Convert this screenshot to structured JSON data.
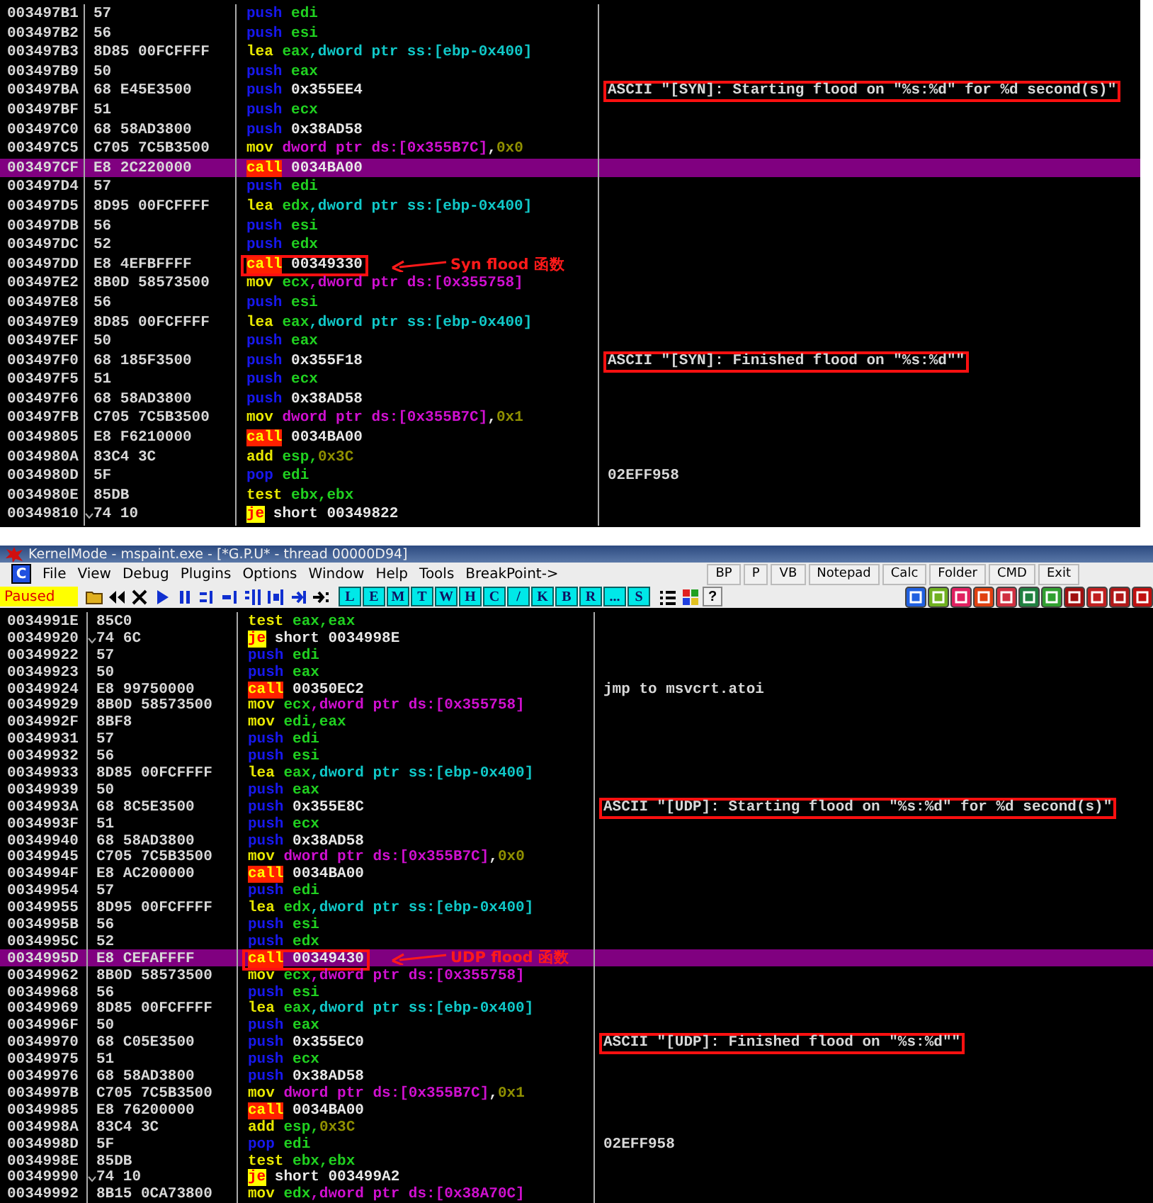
{
  "top_listing": {
    "rows": [
      {
        "address": "003497B1",
        "hex": "57",
        "mnemonic": {
          "text": "push",
          "kind": "stack"
        },
        "operands": [
          {
            "text": "edi",
            "kind": "reg"
          }
        ],
        "selected": false
      },
      {
        "address": "003497B2",
        "hex": "56",
        "mnemonic": {
          "text": "push",
          "kind": "stack"
        },
        "operands": [
          {
            "text": "esi",
            "kind": "reg"
          }
        ],
        "selected": false
      },
      {
        "address": "003497B3",
        "hex": "8D85 00FCFFFF",
        "mnemonic": {
          "text": "lea",
          "kind": "data"
        },
        "operands": [
          {
            "text": "eax",
            "kind": "reg"
          },
          {
            "text": ",dword ptr ss:[ebp-0x400]",
            "kind": "ss"
          }
        ],
        "selected": false
      },
      {
        "address": "003497B9",
        "hex": "50",
        "mnemonic": {
          "text": "push",
          "kind": "stack"
        },
        "operands": [
          {
            "text": "eax",
            "kind": "reg"
          }
        ],
        "selected": false
      },
      {
        "address": "003497BA",
        "hex": "68 E45E3500",
        "mnemonic": {
          "text": "push",
          "kind": "stack"
        },
        "operands": [
          {
            "text": "0x355EE4",
            "kind": "addr"
          }
        ],
        "selected": false,
        "comment": {
          "text": "ASCII \"[SYN]: Starting flood on \"%s:%d\" for %d second(s)\"",
          "boxed": true
        }
      },
      {
        "address": "003497BF",
        "hex": "51",
        "mnemonic": {
          "text": "push",
          "kind": "stack"
        },
        "operands": [
          {
            "text": "ecx",
            "kind": "reg"
          }
        ],
        "selected": false
      },
      {
        "address": "003497C0",
        "hex": "68 58AD3800",
        "mnemonic": {
          "text": "push",
          "kind": "stack"
        },
        "operands": [
          {
            "text": "0x38AD58",
            "kind": "addr"
          }
        ],
        "selected": false
      },
      {
        "address": "003497C5",
        "hex": "C705 7C5B3500",
        "mnemonic": {
          "text": "mov",
          "kind": "data"
        },
        "operands": [
          {
            "text": "dword ptr ds:[0x355B7C]",
            "kind": "ds"
          },
          {
            "text": ",",
            "kind": "addr"
          },
          {
            "text": "0x0",
            "kind": "imm"
          }
        ],
        "selected": false
      },
      {
        "address": "003497CF",
        "hex": "E8 2C220000",
        "mnemonic": {
          "text": "call",
          "kind": "call"
        },
        "operands": [
          {
            "text": "0034BA00",
            "kind": "addr"
          }
        ],
        "selected": true
      },
      {
        "address": "003497D4",
        "hex": "57",
        "mnemonic": {
          "text": "push",
          "kind": "stack"
        },
        "operands": [
          {
            "text": "edi",
            "kind": "reg"
          }
        ],
        "selected": false
      },
      {
        "address": "003497D5",
        "hex": "8D95 00FCFFFF",
        "mnemonic": {
          "text": "lea",
          "kind": "data"
        },
        "operands": [
          {
            "text": "edx",
            "kind": "reg"
          },
          {
            "text": ",dword ptr ss:[ebp-0x400]",
            "kind": "ss"
          }
        ],
        "selected": false
      },
      {
        "address": "003497DB",
        "hex": "56",
        "mnemonic": {
          "text": "push",
          "kind": "stack"
        },
        "operands": [
          {
            "text": "esi",
            "kind": "reg"
          }
        ],
        "selected": false
      },
      {
        "address": "003497DC",
        "hex": "52",
        "mnemonic": {
          "text": "push",
          "kind": "stack"
        },
        "operands": [
          {
            "text": "edx",
            "kind": "reg"
          }
        ],
        "selected": false
      },
      {
        "address": "003497DD",
        "hex": "E8 4EFBFFFF",
        "mnemonic": {
          "text": "call",
          "kind": "call"
        },
        "operands": [
          {
            "text": "00349330",
            "kind": "addr"
          }
        ],
        "selected": false,
        "boxed": true,
        "annotation": "Syn flood 函数"
      },
      {
        "address": "003497E2",
        "hex": "8B0D 58573500",
        "mnemonic": {
          "text": "mov",
          "kind": "data"
        },
        "operands": [
          {
            "text": "ecx",
            "kind": "reg"
          },
          {
            "text": ",dword ptr ds:[0x355758]",
            "kind": "ds"
          }
        ],
        "selected": false
      },
      {
        "address": "003497E8",
        "hex": "56",
        "mnemonic": {
          "text": "push",
          "kind": "stack"
        },
        "operands": [
          {
            "text": "esi",
            "kind": "reg"
          }
        ],
        "selected": false
      },
      {
        "address": "003497E9",
        "hex": "8D85 00FCFFFF",
        "mnemonic": {
          "text": "lea",
          "kind": "data"
        },
        "operands": [
          {
            "text": "eax",
            "kind": "reg"
          },
          {
            "text": ",dword ptr ss:[ebp-0x400]",
            "kind": "ss"
          }
        ],
        "selected": false
      },
      {
        "address": "003497EF",
        "hex": "50",
        "mnemonic": {
          "text": "push",
          "kind": "stack"
        },
        "operands": [
          {
            "text": "eax",
            "kind": "reg"
          }
        ],
        "selected": false
      },
      {
        "address": "003497F0",
        "hex": "68 185F3500",
        "mnemonic": {
          "text": "push",
          "kind": "stack"
        },
        "operands": [
          {
            "text": "0x355F18",
            "kind": "addr"
          }
        ],
        "selected": false,
        "comment": {
          "text": "ASCII \"[SYN]: Finished flood on \"%s:%d\"\"",
          "boxed": true
        }
      },
      {
        "address": "003497F5",
        "hex": "51",
        "mnemonic": {
          "text": "push",
          "kind": "stack"
        },
        "operands": [
          {
            "text": "ecx",
            "kind": "reg"
          }
        ],
        "selected": false
      },
      {
        "address": "003497F6",
        "hex": "68 58AD3800",
        "mnemonic": {
          "text": "push",
          "kind": "stack"
        },
        "operands": [
          {
            "text": "0x38AD58",
            "kind": "addr"
          }
        ],
        "selected": false
      },
      {
        "address": "003497FB",
        "hex": "C705 7C5B3500",
        "mnemonic": {
          "text": "mov",
          "kind": "data"
        },
        "operands": [
          {
            "text": "dword ptr ds:[0x355B7C]",
            "kind": "ds"
          },
          {
            "text": ",",
            "kind": "addr"
          },
          {
            "text": "0x1",
            "kind": "imm"
          }
        ],
        "selected": false
      },
      {
        "address": "00349805",
        "hex": "E8 F6210000",
        "mnemonic": {
          "text": "call",
          "kind": "call"
        },
        "operands": [
          {
            "text": "0034BA00",
            "kind": "addr"
          }
        ],
        "selected": false
      },
      {
        "address": "0034980A",
        "hex": "83C4 3C",
        "mnemonic": {
          "text": "add",
          "kind": "data"
        },
        "operands": [
          {
            "text": "esp,",
            "kind": "reg"
          },
          {
            "text": "0x3C",
            "kind": "imm"
          }
        ],
        "selected": false
      },
      {
        "address": "0034980D",
        "hex": "5F",
        "mnemonic": {
          "text": "pop",
          "kind": "stack"
        },
        "operands": [
          {
            "text": "edi",
            "kind": "reg"
          }
        ],
        "selected": false,
        "comment": {
          "text": "02EFF958",
          "boxed": false
        }
      },
      {
        "address": "0034980E",
        "hex": "85DB",
        "mnemonic": {
          "text": "test",
          "kind": "data"
        },
        "operands": [
          {
            "text": "ebx,ebx",
            "kind": "reg"
          }
        ],
        "selected": false
      },
      {
        "address": "00349810",
        "hex": "74 10",
        "mnemonic": {
          "text": "je",
          "kind": "jump"
        },
        "operands": [
          {
            "text": "short 00349822",
            "kind": "addr"
          }
        ],
        "selected": false,
        "jump_mark": true
      }
    ]
  },
  "window": {
    "title": "KernelMode - mspaint.exe - [*G.P.U* - thread 00000D94]",
    "menu_badge": "C",
    "menu": [
      "File",
      "View",
      "Debug",
      "Plugins",
      "Options",
      "Window",
      "Help",
      "Tools",
      "BreakPoint->"
    ],
    "menu_buttons": [
      "BP",
      "P",
      "VB",
      "Notepad",
      "Calc",
      "Folder",
      "CMD",
      "Exit"
    ],
    "status": "Paused",
    "letter_buttons": [
      "L",
      "E",
      "M",
      "T",
      "W",
      "H",
      "C",
      "/",
      "K",
      "B",
      "R",
      "...",
      "S"
    ],
    "help_button": "?"
  },
  "bottom_listing": {
    "rows": [
      {
        "address": "0034991E",
        "hex": "85C0",
        "mnemonic": {
          "text": "test",
          "kind": "data"
        },
        "operands": [
          {
            "text": "eax,eax",
            "kind": "reg"
          }
        ],
        "selected": false
      },
      {
        "address": "00349920",
        "hex": "74 6C",
        "mnemonic": {
          "text": "je",
          "kind": "jump"
        },
        "operands": [
          {
            "text": "short 0034998E",
            "kind": "addr"
          }
        ],
        "selected": false,
        "jump_mark": true
      },
      {
        "address": "00349922",
        "hex": "57",
        "mnemonic": {
          "text": "push",
          "kind": "stack"
        },
        "operands": [
          {
            "text": "edi",
            "kind": "reg"
          }
        ],
        "selected": false
      },
      {
        "address": "00349923",
        "hex": "50",
        "mnemonic": {
          "text": "push",
          "kind": "stack"
        },
        "operands": [
          {
            "text": "eax",
            "kind": "reg"
          }
        ],
        "selected": false
      },
      {
        "address": "00349924",
        "hex": "E8 99750000",
        "mnemonic": {
          "text": "call",
          "kind": "call"
        },
        "operands": [
          {
            "text": "00350EC2",
            "kind": "addr"
          }
        ],
        "selected": false,
        "comment": {
          "text": "jmp to msvcrt.atoi",
          "boxed": false
        }
      },
      {
        "address": "00349929",
        "hex": "8B0D 58573500",
        "mnemonic": {
          "text": "mov",
          "kind": "data"
        },
        "operands": [
          {
            "text": "ecx",
            "kind": "reg"
          },
          {
            "text": ",dword ptr ds:[0x355758]",
            "kind": "ds"
          }
        ],
        "selected": false
      },
      {
        "address": "0034992F",
        "hex": "8BF8",
        "mnemonic": {
          "text": "mov",
          "kind": "data"
        },
        "operands": [
          {
            "text": "edi,eax",
            "kind": "reg"
          }
        ],
        "selected": false
      },
      {
        "address": "00349931",
        "hex": "57",
        "mnemonic": {
          "text": "push",
          "kind": "stack"
        },
        "operands": [
          {
            "text": "edi",
            "kind": "reg"
          }
        ],
        "selected": false
      },
      {
        "address": "00349932",
        "hex": "56",
        "mnemonic": {
          "text": "push",
          "kind": "stack"
        },
        "operands": [
          {
            "text": "esi",
            "kind": "reg"
          }
        ],
        "selected": false
      },
      {
        "address": "00349933",
        "hex": "8D85 00FCFFFF",
        "mnemonic": {
          "text": "lea",
          "kind": "data"
        },
        "operands": [
          {
            "text": "eax",
            "kind": "reg"
          },
          {
            "text": ",dword ptr ss:[ebp-0x400]",
            "kind": "ss"
          }
        ],
        "selected": false
      },
      {
        "address": "00349939",
        "hex": "50",
        "mnemonic": {
          "text": "push",
          "kind": "stack"
        },
        "operands": [
          {
            "text": "eax",
            "kind": "reg"
          }
        ],
        "selected": false
      },
      {
        "address": "0034993A",
        "hex": "68 8C5E3500",
        "mnemonic": {
          "text": "push",
          "kind": "stack"
        },
        "operands": [
          {
            "text": "0x355E8C",
            "kind": "addr"
          }
        ],
        "selected": false,
        "comment": {
          "text": "ASCII \"[UDP]: Starting flood on \"%s:%d\" for %d second(s)\"",
          "boxed": true
        }
      },
      {
        "address": "0034993F",
        "hex": "51",
        "mnemonic": {
          "text": "push",
          "kind": "stack"
        },
        "operands": [
          {
            "text": "ecx",
            "kind": "reg"
          }
        ],
        "selected": false
      },
      {
        "address": "00349940",
        "hex": "68 58AD3800",
        "mnemonic": {
          "text": "push",
          "kind": "stack"
        },
        "operands": [
          {
            "text": "0x38AD58",
            "kind": "addr"
          }
        ],
        "selected": false
      },
      {
        "address": "00349945",
        "hex": "C705 7C5B3500",
        "mnemonic": {
          "text": "mov",
          "kind": "data"
        },
        "operands": [
          {
            "text": "dword ptr ds:[0x355B7C]",
            "kind": "ds"
          },
          {
            "text": ",",
            "kind": "addr"
          },
          {
            "text": "0x0",
            "kind": "imm"
          }
        ],
        "selected": false
      },
      {
        "address": "0034994F",
        "hex": "E8 AC200000",
        "mnemonic": {
          "text": "call",
          "kind": "call"
        },
        "operands": [
          {
            "text": "0034BA00",
            "kind": "addr"
          }
        ],
        "selected": false
      },
      {
        "address": "00349954",
        "hex": "57",
        "mnemonic": {
          "text": "push",
          "kind": "stack"
        },
        "operands": [
          {
            "text": "edi",
            "kind": "reg"
          }
        ],
        "selected": false
      },
      {
        "address": "00349955",
        "hex": "8D95 00FCFFFF",
        "mnemonic": {
          "text": "lea",
          "kind": "data"
        },
        "operands": [
          {
            "text": "edx",
            "kind": "reg"
          },
          {
            "text": ",dword ptr ss:[ebp-0x400]",
            "kind": "ss"
          }
        ],
        "selected": false
      },
      {
        "address": "0034995B",
        "hex": "56",
        "mnemonic": {
          "text": "push",
          "kind": "stack"
        },
        "operands": [
          {
            "text": "esi",
            "kind": "reg"
          }
        ],
        "selected": false
      },
      {
        "address": "0034995C",
        "hex": "52",
        "mnemonic": {
          "text": "push",
          "kind": "stack"
        },
        "operands": [
          {
            "text": "edx",
            "kind": "reg"
          }
        ],
        "selected": false
      },
      {
        "address": "0034995D",
        "hex": "E8 CEFAFFFF",
        "mnemonic": {
          "text": "call",
          "kind": "call"
        },
        "operands": [
          {
            "text": "00349430",
            "kind": "addr"
          }
        ],
        "selected": true,
        "boxed": true,
        "annotation": "UDP flood 函数"
      },
      {
        "address": "00349962",
        "hex": "8B0D 58573500",
        "mnemonic": {
          "text": "mov",
          "kind": "data"
        },
        "operands": [
          {
            "text": "ecx",
            "kind": "reg"
          },
          {
            "text": ",dword ptr ds:[0x355758]",
            "kind": "ds"
          }
        ],
        "selected": false
      },
      {
        "address": "00349968",
        "hex": "56",
        "mnemonic": {
          "text": "push",
          "kind": "stack"
        },
        "operands": [
          {
            "text": "esi",
            "kind": "reg"
          }
        ],
        "selected": false
      },
      {
        "address": "00349969",
        "hex": "8D85 00FCFFFF",
        "mnemonic": {
          "text": "lea",
          "kind": "data"
        },
        "operands": [
          {
            "text": "eax",
            "kind": "reg"
          },
          {
            "text": ",dword ptr ss:[ebp-0x400]",
            "kind": "ss"
          }
        ],
        "selected": false
      },
      {
        "address": "0034996F",
        "hex": "50",
        "mnemonic": {
          "text": "push",
          "kind": "stack"
        },
        "operands": [
          {
            "text": "eax",
            "kind": "reg"
          }
        ],
        "selected": false
      },
      {
        "address": "00349970",
        "hex": "68 C05E3500",
        "mnemonic": {
          "text": "push",
          "kind": "stack"
        },
        "operands": [
          {
            "text": "0x355EC0",
            "kind": "addr"
          }
        ],
        "selected": false,
        "comment": {
          "text": "ASCII \"[UDP]: Finished flood on \"%s:%d\"\"",
          "boxed": true
        }
      },
      {
        "address": "00349975",
        "hex": "51",
        "mnemonic": {
          "text": "push",
          "kind": "stack"
        },
        "operands": [
          {
            "text": "ecx",
            "kind": "reg"
          }
        ],
        "selected": false
      },
      {
        "address": "00349976",
        "hex": "68 58AD3800",
        "mnemonic": {
          "text": "push",
          "kind": "stack"
        },
        "operands": [
          {
            "text": "0x38AD58",
            "kind": "addr"
          }
        ],
        "selected": false
      },
      {
        "address": "0034997B",
        "hex": "C705 7C5B3500",
        "mnemonic": {
          "text": "mov",
          "kind": "data"
        },
        "operands": [
          {
            "text": "dword ptr ds:[0x355B7C]",
            "kind": "ds"
          },
          {
            "text": ",",
            "kind": "addr"
          },
          {
            "text": "0x1",
            "kind": "imm"
          }
        ],
        "selected": false
      },
      {
        "address": "00349985",
        "hex": "E8 76200000",
        "mnemonic": {
          "text": "call",
          "kind": "call"
        },
        "operands": [
          {
            "text": "0034BA00",
            "kind": "addr"
          }
        ],
        "selected": false
      },
      {
        "address": "0034998A",
        "hex": "83C4 3C",
        "mnemonic": {
          "text": "add",
          "kind": "data"
        },
        "operands": [
          {
            "text": "esp,",
            "kind": "reg"
          },
          {
            "text": "0x3C",
            "kind": "imm"
          }
        ],
        "selected": false
      },
      {
        "address": "0034998D",
        "hex": "5F",
        "mnemonic": {
          "text": "pop",
          "kind": "stack"
        },
        "operands": [
          {
            "text": "edi",
            "kind": "reg"
          }
        ],
        "selected": false,
        "comment": {
          "text": "02EFF958",
          "boxed": false
        }
      },
      {
        "address": "0034998E",
        "hex": "85DB",
        "mnemonic": {
          "text": "test",
          "kind": "data"
        },
        "operands": [
          {
            "text": "ebx,ebx",
            "kind": "reg"
          }
        ],
        "selected": false
      },
      {
        "address": "00349990",
        "hex": "74 10",
        "mnemonic": {
          "text": "je",
          "kind": "jump"
        },
        "operands": [
          {
            "text": "short 003499A2",
            "kind": "addr"
          }
        ],
        "selected": false,
        "jump_mark": true
      },
      {
        "address": "00349992",
        "hex": "8B15 0CA73800",
        "mnemonic": {
          "text": "mov",
          "kind": "data"
        },
        "operands": [
          {
            "text": "edx",
            "kind": "reg"
          },
          {
            "text": ",dword ptr ds:[0x38A70C]",
            "kind": "ds"
          }
        ],
        "selected": false
      }
    ]
  }
}
